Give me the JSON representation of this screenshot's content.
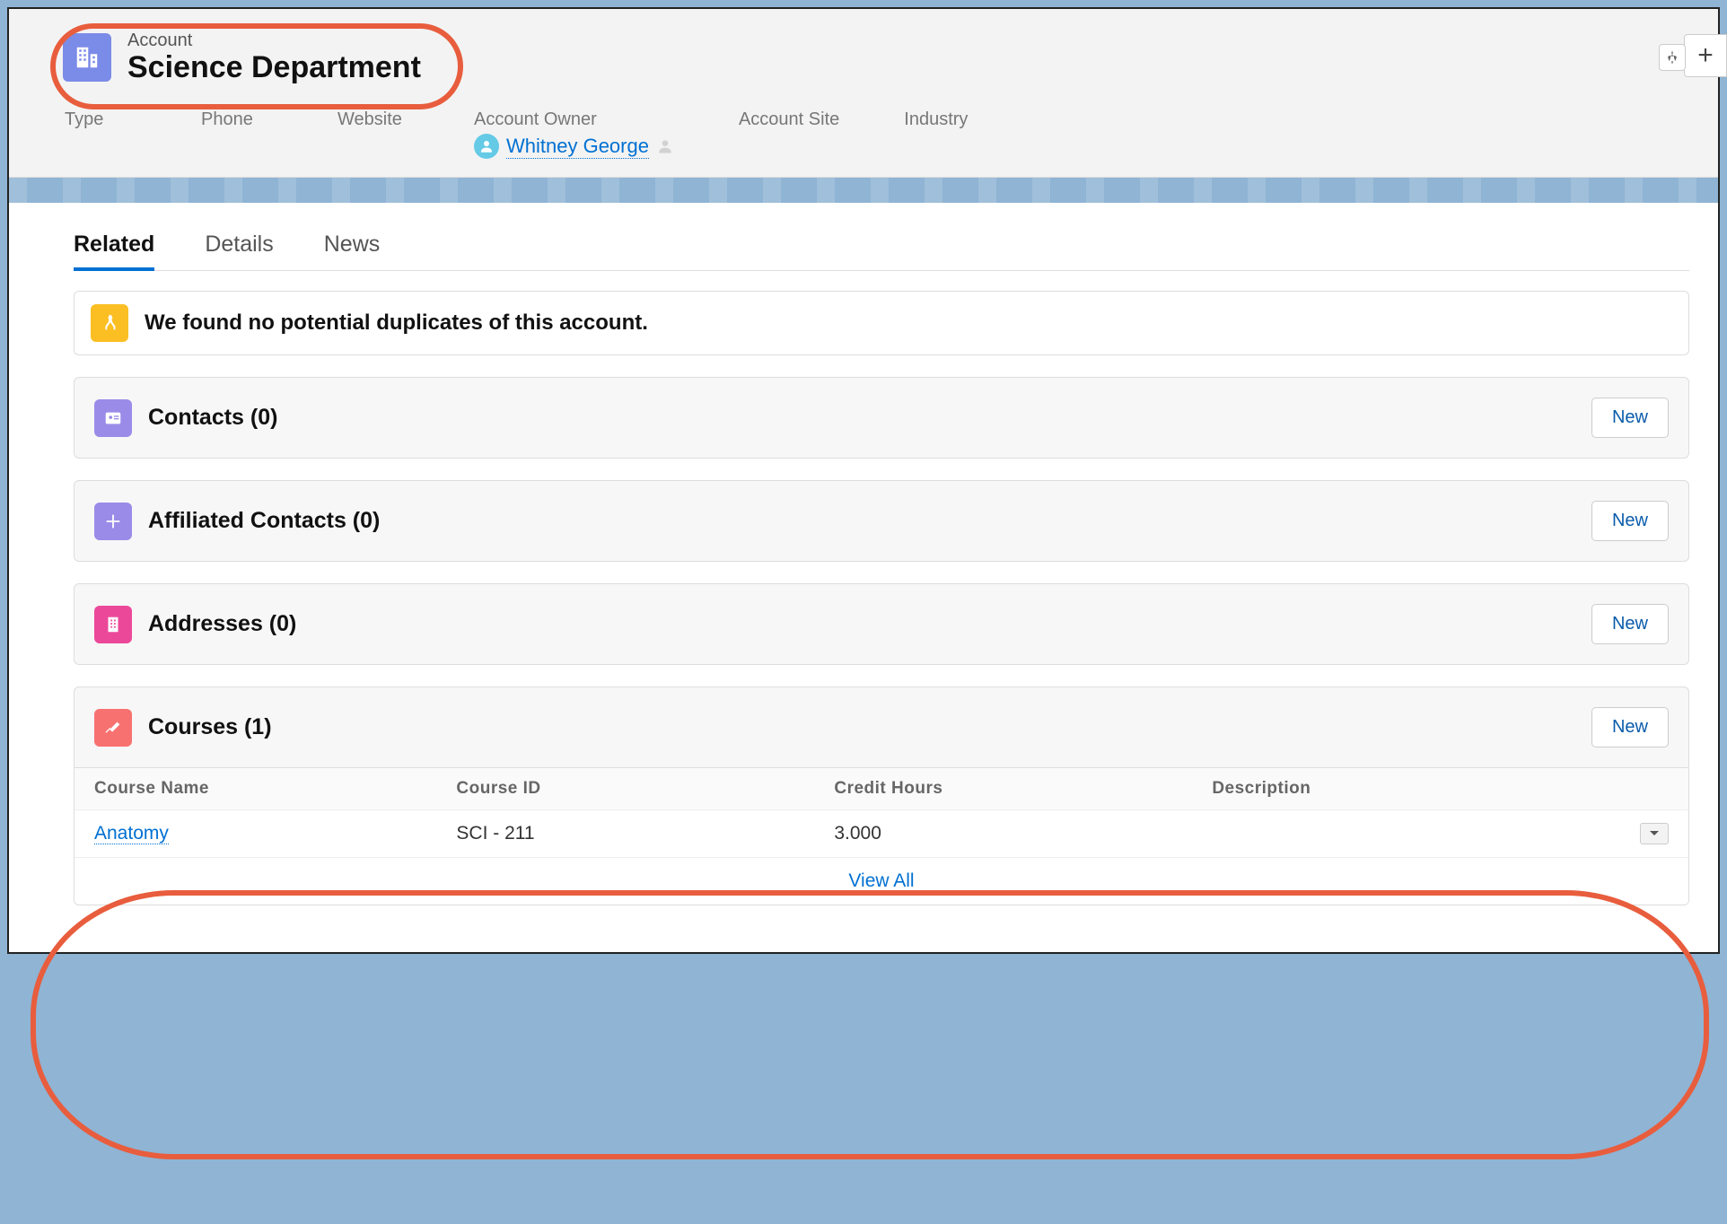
{
  "header": {
    "entity_label": "Account",
    "entity_name": "Science Department"
  },
  "fields": [
    {
      "label": "Type"
    },
    {
      "label": "Phone"
    },
    {
      "label": "Website"
    },
    {
      "label": "Account Owner",
      "owner": "Whitney George"
    },
    {
      "label": "Account Site"
    },
    {
      "label": "Industry"
    }
  ],
  "tabs": [
    {
      "label": "Related",
      "active": true
    },
    {
      "label": "Details",
      "active": false
    },
    {
      "label": "News",
      "active": false
    }
  ],
  "duplicates_message": "We found no potential duplicates of this account.",
  "related": {
    "contacts": {
      "title": "Contacts (0)",
      "action": "New"
    },
    "affiliated": {
      "title": "Affiliated Contacts (0)",
      "action": "New"
    },
    "addresses": {
      "title": "Addresses (0)",
      "action": "New"
    },
    "courses": {
      "title": "Courses (1)",
      "action": "New",
      "columns": [
        "Course Name",
        "Course ID",
        "Credit Hours",
        "Description"
      ],
      "rows": [
        {
          "name": "Anatomy",
          "id": "SCI - 211",
          "hours": "3.000",
          "desc": ""
        }
      ],
      "view_all": "View All"
    }
  }
}
